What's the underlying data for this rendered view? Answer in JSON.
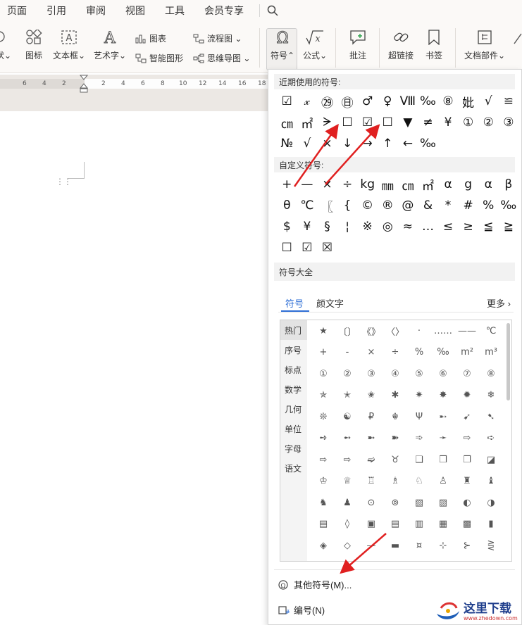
{
  "menu": {
    "items": [
      "页面",
      "引用",
      "审阅",
      "视图",
      "工具",
      "会员专享"
    ]
  },
  "ribbon": {
    "shape_label": "状",
    "icon_label": "图标",
    "textbox_label": "文本框",
    "arttext_label": "艺术字",
    "chart_label": "图表",
    "smartart_label": "智能图形",
    "flowchart_label": "流程图",
    "mindmap_label": "思维导图",
    "symbol_label": "符号",
    "formula_label": "公式",
    "comment_label": "批注",
    "hyperlink_label": "超链接",
    "bookmark_label": "书签",
    "docpart_label": "文档部件",
    "formula_glyph": "√x"
  },
  "ruler": {
    "ticks": [
      "6",
      "4",
      "2",
      "2",
      "4",
      "6",
      "8",
      "10",
      "12",
      "14",
      "16",
      "18"
    ]
  },
  "panel": {
    "recent_title": "近期使用的符号:",
    "recent": [
      "☑",
      "𝓍",
      "㉙",
      "㊐",
      "♂",
      "♀",
      "Ⅷ",
      "‰",
      "⑧",
      "妣",
      "√",
      "≌",
      "㎝",
      "㎡",
      "ᗒ",
      "☐",
      "☑",
      "☐",
      "▼",
      "≠",
      "¥",
      "①",
      "②",
      "③",
      "№",
      "√",
      "×",
      "↓",
      "→",
      "↑",
      "←",
      "‰"
    ],
    "custom_title": "自定义符号:",
    "custom": [
      "+",
      "—",
      "×",
      "÷",
      "kg",
      "㎜",
      "㎝",
      "㎡",
      "α",
      "g",
      "α",
      "β",
      "θ",
      "℃",
      "〖",
      "{",
      "©",
      "®",
      "@",
      "&",
      "*",
      "#",
      "%",
      "‰",
      "$",
      "¥",
      "§",
      "¦",
      "※",
      "◎",
      "≈",
      "…",
      "≤",
      "≥",
      "≦",
      "≧",
      "☐",
      "☑",
      "☒"
    ],
    "all_title": "符号大全",
    "tabs": {
      "symbols": "符号",
      "kaomoji": "颜文字",
      "more": "更多"
    },
    "categories": [
      "热门",
      "序号",
      "标点",
      "数学",
      "几何",
      "单位",
      "字母",
      "语文"
    ],
    "symbols": [
      "★",
      "〔〕",
      "《》",
      "〈〉",
      "·",
      "……",
      "——",
      "℃",
      "+",
      "-",
      "×",
      "÷",
      "%",
      "‰",
      "m²",
      "m³",
      "①",
      "②",
      "③",
      "④",
      "⑤",
      "⑥",
      "⑦",
      "⑧",
      "✯",
      "✭",
      "✬",
      "✱",
      "✷",
      "✸",
      "✹",
      "❄",
      "❊",
      "☯",
      "₽",
      "☬",
      "Ψ",
      "➸",
      "➹",
      "➷",
      "➺",
      "➻",
      "➼",
      "➽",
      "➾",
      "➛",
      "⇨",
      "➪",
      "⇨",
      "⇨",
      "➫",
      "♉",
      "❑",
      "❒",
      "❐",
      "◪",
      "♔",
      "♕",
      "♖",
      "♗",
      "♘",
      "♙",
      "♜",
      "♝",
      "♞",
      "♟",
      "⊙",
      "⊚",
      "▧",
      "▨",
      "◐",
      "◑",
      "▤",
      "◊",
      "▣",
      "▤",
      "▥",
      "▦",
      "▩",
      "▮",
      "◈",
      "◇",
      "—",
      "▬",
      "¤",
      "⊹",
      "⊱",
      "⋛"
    ],
    "more_symbols_label": "其他符号(M)...",
    "numbering_label": "编号(N)"
  },
  "watermark": {
    "title": "这里下载",
    "url": "www.zhedown.com"
  },
  "colors": {
    "accent": "#2f6fd6",
    "arrow": "#e02020"
  }
}
